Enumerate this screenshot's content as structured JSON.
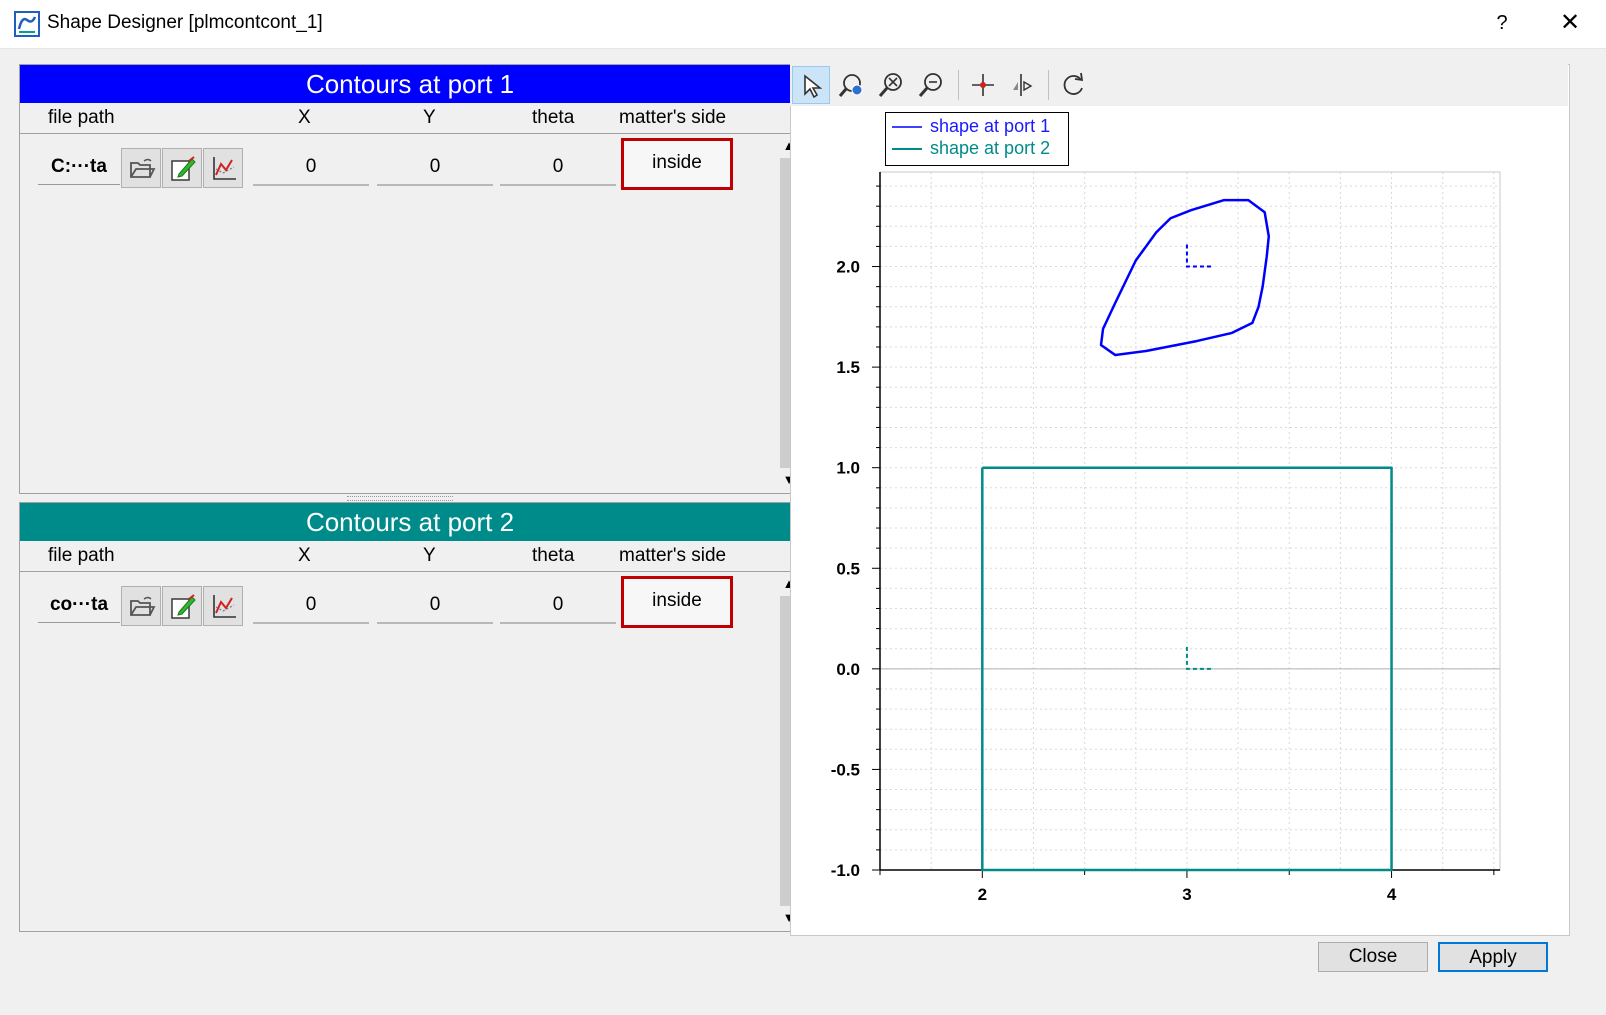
{
  "window": {
    "title": "Shape Designer [plmcontcont_1]",
    "help_label": "?",
    "close_glyph": "✕"
  },
  "columns": [
    "file path",
    "X",
    "Y",
    "theta",
    "matter's side"
  ],
  "port1": {
    "header": "Contours at port 1",
    "header_color": "#0000ff",
    "row": {
      "path": "C:···ta",
      "x": "0",
      "y": "0",
      "theta": "0",
      "side": "inside"
    }
  },
  "port2": {
    "header": "Contours at port 2",
    "header_color": "#008b8b",
    "row": {
      "path": "co···ta",
      "x": "0",
      "y": "0",
      "theta": "0",
      "side": "inside"
    }
  },
  "row_icons": [
    "open-folder-icon",
    "edit-icon",
    "plot-curve-icon"
  ],
  "toolbar_icons": [
    "pointer-icon",
    "zoom-fit-icon",
    "zoom-in-icon",
    "zoom-out-icon",
    "crosshair-icon",
    "mirror-icon",
    "refresh-icon"
  ],
  "chart_data": {
    "type": "line",
    "xlim": [
      1.5,
      4.53
    ],
    "ylim": [
      -1.0,
      2.47
    ],
    "x_ticks": [
      "2",
      "3",
      "4"
    ],
    "y_ticks": [
      "-1.0",
      "-0.5",
      "0.0",
      "0.5",
      "1.0",
      "1.5",
      "2.0"
    ],
    "grid": true,
    "legend_position": "top-left",
    "series": [
      {
        "name": "shape at port 1",
        "color": "#0000ff",
        "x": [
          3.02,
          3.18,
          3.3,
          3.38,
          3.4,
          3.39,
          3.37,
          3.35,
          3.32,
          3.22,
          3.05,
          2.8,
          2.65,
          2.58,
          2.59,
          2.65,
          2.75,
          2.85,
          2.92,
          3.02
        ],
        "y": [
          2.28,
          2.33,
          2.33,
          2.27,
          2.15,
          2.05,
          1.9,
          1.8,
          1.72,
          1.67,
          1.63,
          1.58,
          1.56,
          1.61,
          1.69,
          1.82,
          2.03,
          2.17,
          2.24,
          2.28
        ]
      },
      {
        "name": "shape at port 2",
        "color": "#008b8b",
        "x": [
          2,
          4,
          4,
          2,
          2
        ],
        "y": [
          1,
          1,
          -1,
          -1,
          1
        ]
      }
    ],
    "frame_markers": [
      {
        "x": 3,
        "y": 2,
        "color": "#0000ff"
      },
      {
        "x": 3,
        "y": 0,
        "color": "#008b8b"
      }
    ]
  },
  "buttons": {
    "close": "Close",
    "apply": "Apply"
  }
}
